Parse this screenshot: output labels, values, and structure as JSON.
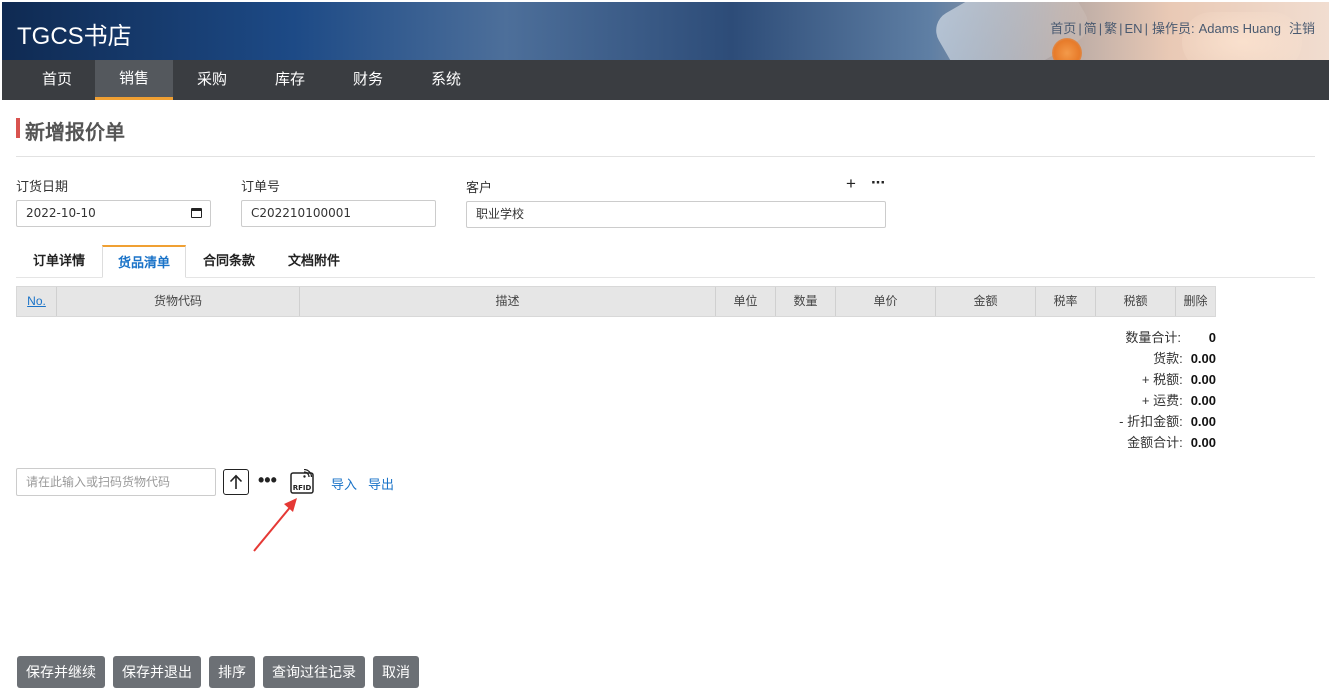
{
  "header": {
    "logo": "TGCS书店",
    "links": {
      "home": "首页",
      "simplified": "简",
      "traditional": "繁",
      "english": "EN",
      "operator_label": "操作员:",
      "operator_name": "Adams Huang",
      "logout": "注销"
    }
  },
  "nav": {
    "items": [
      {
        "label": "首页",
        "active": false
      },
      {
        "label": "销售",
        "active": true
      },
      {
        "label": "采购",
        "active": false
      },
      {
        "label": "库存",
        "active": false
      },
      {
        "label": "财务",
        "active": false
      },
      {
        "label": "系统",
        "active": false
      }
    ]
  },
  "page": {
    "title": "新增报价单"
  },
  "form": {
    "order_date": {
      "label": "订货日期",
      "value": "2022-10-10"
    },
    "order_no": {
      "label": "订单号",
      "value": "C202210100001"
    },
    "customer": {
      "label": "客户",
      "value": "职业学校",
      "add_icon": "plus-icon",
      "more_icon": "more-icon"
    }
  },
  "tabs": [
    {
      "label": "订单详情",
      "active": false
    },
    {
      "label": "货品清单",
      "active": true
    },
    {
      "label": "合同条款",
      "active": false
    },
    {
      "label": "文档附件",
      "active": false
    }
  ],
  "table": {
    "columns": [
      "No.",
      "货物代码",
      "描述",
      "单位",
      "数量",
      "单价",
      "金额",
      "税率",
      "税额",
      "删除"
    ]
  },
  "totals": {
    "qty_label": "数量合计:",
    "qty_value": "0",
    "goods_label": "货款:",
    "goods_value": "0.00",
    "tax_label": "+ 税额:",
    "tax_value": "0.00",
    "freight_label": "+ 运费:",
    "freight_value": "0.00",
    "discount_label": "- 折扣金额:",
    "discount_value": "0.00",
    "total_label": "金额合计:",
    "total_value": "0.00"
  },
  "scan": {
    "placeholder": "请在此输入或扫码货物代码",
    "import_label": "导入",
    "export_label": "导出",
    "rfid_text": "RFID"
  },
  "buttons": {
    "save_continue": "保存并继续",
    "save_exit": "保存并退出",
    "sort": "排序",
    "history": "查询过往记录",
    "cancel": "取消"
  },
  "colors": {
    "accent": "#f0a033",
    "title_bar": "#d9534f",
    "link": "#1a73c8",
    "nav_bg": "#3a3d41",
    "button_bg": "#6c7075",
    "annotation_arrow": "#e53935"
  }
}
